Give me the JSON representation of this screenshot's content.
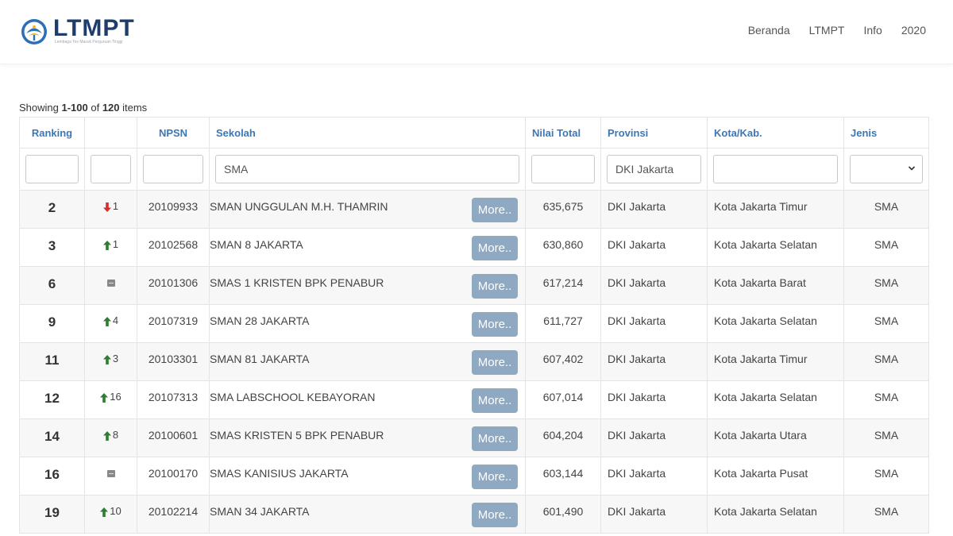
{
  "brand": {
    "name": "LTMPT",
    "subtitle": "Lembaga Tes Masuk Perguruan Tinggi"
  },
  "nav": [
    "Beranda",
    "LTMPT",
    "Info",
    "2020"
  ],
  "summary": {
    "prefix": "Showing ",
    "range": "1-100",
    "mid": " of ",
    "total": "120",
    "suffix": " items"
  },
  "columns": [
    "Ranking",
    "",
    "NPSN",
    "Sekolah",
    "Nilai Total",
    "Provinsi",
    "Kota/Kab.",
    "Jenis"
  ],
  "filters": {
    "ranking": "",
    "change": "",
    "npsn": "",
    "sekolah": "SMA",
    "nilai": "",
    "provinsi": "DKI Jakarta",
    "kota": "",
    "jenis": ""
  },
  "more_label": "More..",
  "colors": {
    "up": "#2e7d32",
    "down": "#d32f2f",
    "same": "#888888",
    "header": "#3c77b7",
    "button": "#8fa9c2"
  },
  "rows": [
    {
      "rank": "2",
      "change": "down",
      "change_value": "1",
      "npsn": "20109933",
      "school": "SMAN UNGGULAN M.H. THAMRIN",
      "total": "635,675",
      "province": "DKI Jakarta",
      "city": "Kota Jakarta Timur",
      "type": "SMA"
    },
    {
      "rank": "3",
      "change": "up",
      "change_value": "1",
      "npsn": "20102568",
      "school": "SMAN 8 JAKARTA",
      "total": "630,860",
      "province": "DKI Jakarta",
      "city": "Kota Jakarta Selatan",
      "type": "SMA"
    },
    {
      "rank": "6",
      "change": "same",
      "change_value": "",
      "npsn": "20101306",
      "school": "SMAS 1 KRISTEN BPK PENABUR",
      "total": "617,214",
      "province": "DKI Jakarta",
      "city": "Kota Jakarta Barat",
      "type": "SMA"
    },
    {
      "rank": "9",
      "change": "up",
      "change_value": "4",
      "npsn": "20107319",
      "school": "SMAN 28 JAKARTA",
      "total": "611,727",
      "province": "DKI Jakarta",
      "city": "Kota Jakarta Selatan",
      "type": "SMA"
    },
    {
      "rank": "11",
      "change": "up",
      "change_value": "3",
      "npsn": "20103301",
      "school": "SMAN 81 JAKARTA",
      "total": "607,402",
      "province": "DKI Jakarta",
      "city": "Kota Jakarta Timur",
      "type": "SMA"
    },
    {
      "rank": "12",
      "change": "up",
      "change_value": "16",
      "npsn": "20107313",
      "school": "SMA LABSCHOOL KEBAYORAN",
      "total": "607,014",
      "province": "DKI Jakarta",
      "city": "Kota Jakarta Selatan",
      "type": "SMA"
    },
    {
      "rank": "14",
      "change": "up",
      "change_value": "8",
      "npsn": "20100601",
      "school": "SMAS KRISTEN 5 BPK PENABUR",
      "total": "604,204",
      "province": "DKI Jakarta",
      "city": "Kota Jakarta Utara",
      "type": "SMA"
    },
    {
      "rank": "16",
      "change": "same",
      "change_value": "",
      "npsn": "20100170",
      "school": "SMAS KANISIUS JAKARTA",
      "total": "603,144",
      "province": "DKI Jakarta",
      "city": "Kota Jakarta Pusat",
      "type": "SMA"
    },
    {
      "rank": "19",
      "change": "up",
      "change_value": "10",
      "npsn": "20102214",
      "school": "SMAN 34 JAKARTA",
      "total": "601,490",
      "province": "DKI Jakarta",
      "city": "Kota Jakarta Selatan",
      "type": "SMA"
    }
  ]
}
